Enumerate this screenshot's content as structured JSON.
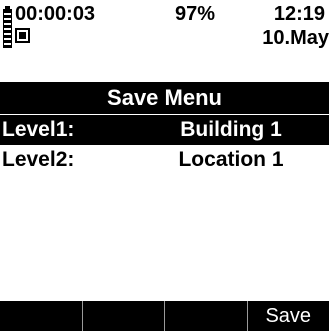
{
  "status": {
    "timer": "00:00:03",
    "battery_percent": "97%",
    "time": "12:19",
    "date": "10.May"
  },
  "title": "Save Menu",
  "menu": {
    "items": [
      {
        "label": "Level1:",
        "value": "Building 1",
        "selected": true
      },
      {
        "label": "Level2:",
        "value": "Location 1",
        "selected": false
      }
    ]
  },
  "softkeys": [
    "",
    "",
    "",
    "Save"
  ],
  "colors": {
    "background": "#ffffff",
    "foreground": "#000000",
    "highlight": "#000000",
    "highlight_text": "#ffffff"
  },
  "icons": {
    "battery": "battery-icon",
    "recording": "record-icon"
  }
}
